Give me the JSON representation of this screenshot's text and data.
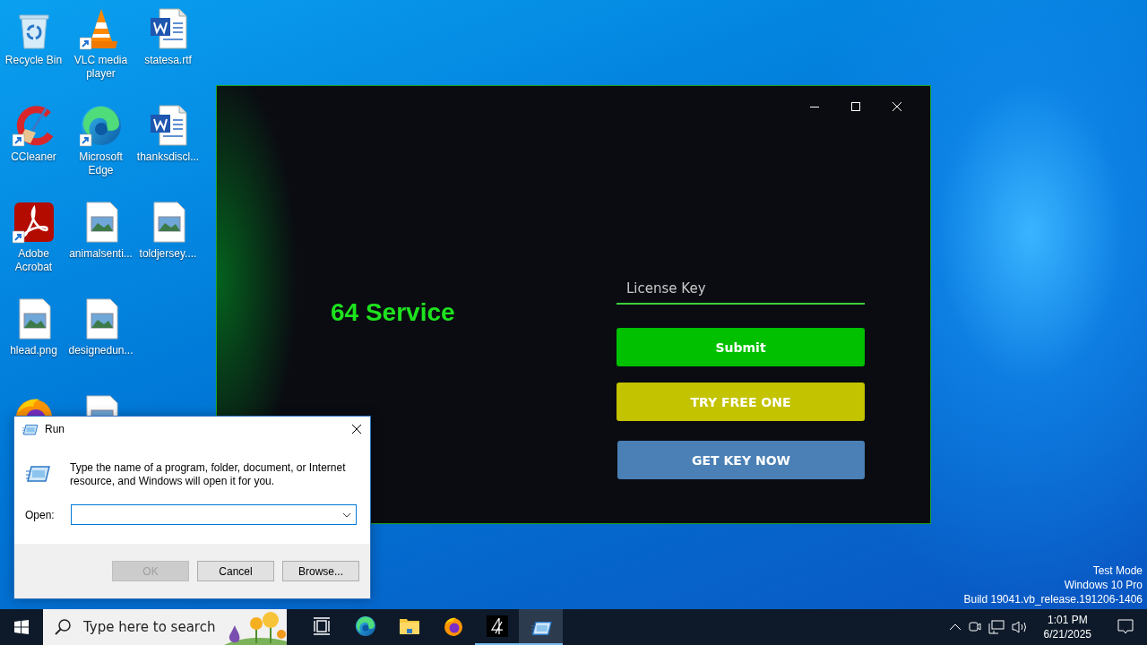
{
  "desktop": {
    "icons": [
      {
        "label": "Recycle Bin",
        "kind": "recycle",
        "shortcut": false
      },
      {
        "label": "CCleaner",
        "kind": "ccleaner",
        "shortcut": true
      },
      {
        "label": "Adobe Acrobat",
        "kind": "acrobat",
        "shortcut": true
      },
      {
        "label": "hlead.png",
        "kind": "image",
        "shortcut": false
      },
      {
        "kind": "firefox"
      },
      {
        "label": "VLC media player",
        "kind": "vlc",
        "shortcut": true
      },
      {
        "label": "Microsoft Edge",
        "kind": "edge",
        "shortcut": true
      },
      {
        "label": "animalsenti...",
        "kind": "image",
        "shortcut": false
      },
      {
        "label": "designedun...",
        "kind": "image",
        "shortcut": false
      },
      {
        "kind": "image"
      },
      {
        "label": "statesa.rtf",
        "kind": "word",
        "shortcut": false
      },
      {
        "label": "thanksdiscl...",
        "kind": "word",
        "shortcut": false
      },
      {
        "label": "toldjersey....",
        "kind": "image",
        "shortcut": false
      }
    ],
    "system_text": [
      "Test Mode",
      "Windows 10 Pro",
      "Build 19041.vb_release.191206-1406"
    ]
  },
  "app_window": {
    "heading": "64 Service",
    "license_field": {
      "placeholder": "License Key"
    },
    "buttons": [
      {
        "label": "Submit",
        "color": "#00c000"
      },
      {
        "label": "TRY FREE ONE",
        "color": "#c3c300"
      },
      {
        "label": "GET KEY NOW",
        "color": "#4a80b5"
      }
    ]
  },
  "run_dialog": {
    "title": "Run",
    "description": "Type the name of a program, folder, document, or Internet resource, and Windows will open it for you.",
    "open_label": "Open:",
    "buttons": [
      {
        "label": "OK",
        "disabled": true
      },
      {
        "label": "Cancel",
        "disabled": false
      },
      {
        "label": "Browse...",
        "disabled": false
      }
    ]
  },
  "taskbar": {
    "search": {
      "placeholder": "Type here to search"
    },
    "apps": [
      {
        "kind": "taskview",
        "running": false,
        "active": false
      },
      {
        "kind": "edge",
        "running": false,
        "active": false
      },
      {
        "kind": "explorer",
        "running": false,
        "active": false
      },
      {
        "kind": "firefox",
        "running": false,
        "active": false
      },
      {
        "kind": "app4",
        "running": true,
        "active": false
      },
      {
        "kind": "run",
        "running": true,
        "active": true
      }
    ],
    "clock": {
      "time": "1:01 PM",
      "date": "6/21/2025"
    }
  }
}
